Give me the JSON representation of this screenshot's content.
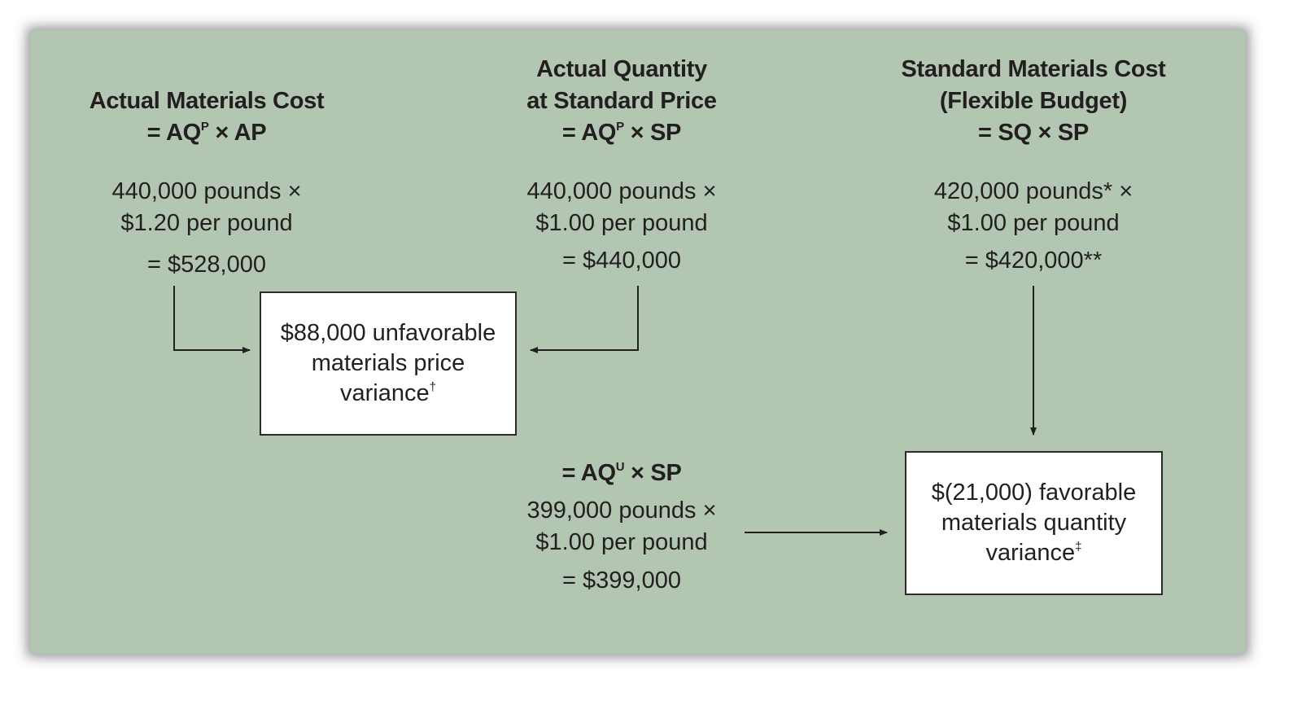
{
  "colors": {
    "panel_background": "#b2c6b2",
    "text": "#231f20",
    "box_background": "#ffffff",
    "box_border": "#2b2b2b",
    "arrow": "#231f20"
  },
  "columns": {
    "actual_cost": {
      "heading_lines": [
        "Actual Materials Cost"
      ],
      "formula_prefix": "= AQ",
      "formula_sup": "P",
      "formula_suffix": " × AP",
      "calc_line1": "440,000 pounds ×",
      "calc_line2": "$1.20 per pound",
      "result": "=  $528,000"
    },
    "actual_qty_std_price": {
      "heading_lines": [
        "Actual Quantity",
        "at Standard Price"
      ],
      "formula_prefix": "= AQ",
      "formula_sup": "P",
      "formula_suffix": " × SP",
      "calc_line1": "440,000 pounds ×",
      "calc_line2": "$1.00 per pound",
      "result": "=  $440,000"
    },
    "standard_cost": {
      "heading_lines": [
        "Standard Materials Cost",
        "(Flexible Budget)"
      ],
      "formula": "= SQ × SP",
      "calc_line1": "420,000 pounds* ×",
      "calc_line2": "$1.00 per pound",
      "result": "=  $420,000**"
    },
    "actual_used_std_price": {
      "formula_prefix": "= AQ",
      "formula_sup": "U",
      "formula_suffix": " × SP",
      "calc_line1": "399,000 pounds ×",
      "calc_line2": "$1.00 per pound",
      "result": "=  $399,000"
    }
  },
  "variances": {
    "price": {
      "line1": "$88,000 unfavorable",
      "line2": "materials price",
      "line3": "variance",
      "footnote_mark": "†"
    },
    "quantity": {
      "line1": "$(21,000) favorable",
      "line2": "materials quantity",
      "line3": "variance",
      "footnote_mark": "‡"
    }
  }
}
